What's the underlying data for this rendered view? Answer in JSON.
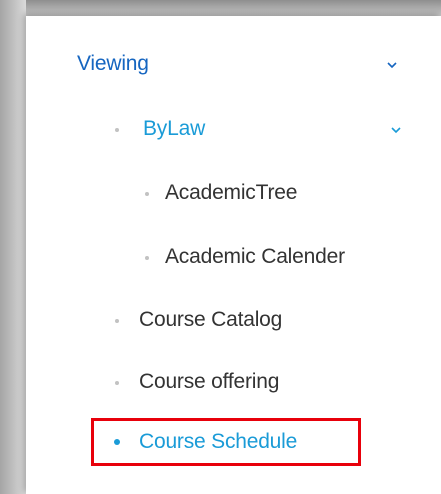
{
  "menu": {
    "viewing": {
      "label": "Viewing",
      "color": "#1565c0",
      "icon": "chevron-down-icon"
    },
    "bylaw": {
      "label": "ByLaw",
      "color": "#1a9bd7",
      "icon": "chevron-down-icon"
    },
    "items": [
      {
        "label": "AcademicTree"
      },
      {
        "label": "Academic Calender"
      },
      {
        "label": "Course Catalog"
      },
      {
        "label": "Course offering"
      },
      {
        "label": "Course Schedule",
        "active": true
      }
    ]
  },
  "colors": {
    "text": "#333333",
    "accent": "#1a9bd7",
    "highlight": "#e8000b"
  }
}
